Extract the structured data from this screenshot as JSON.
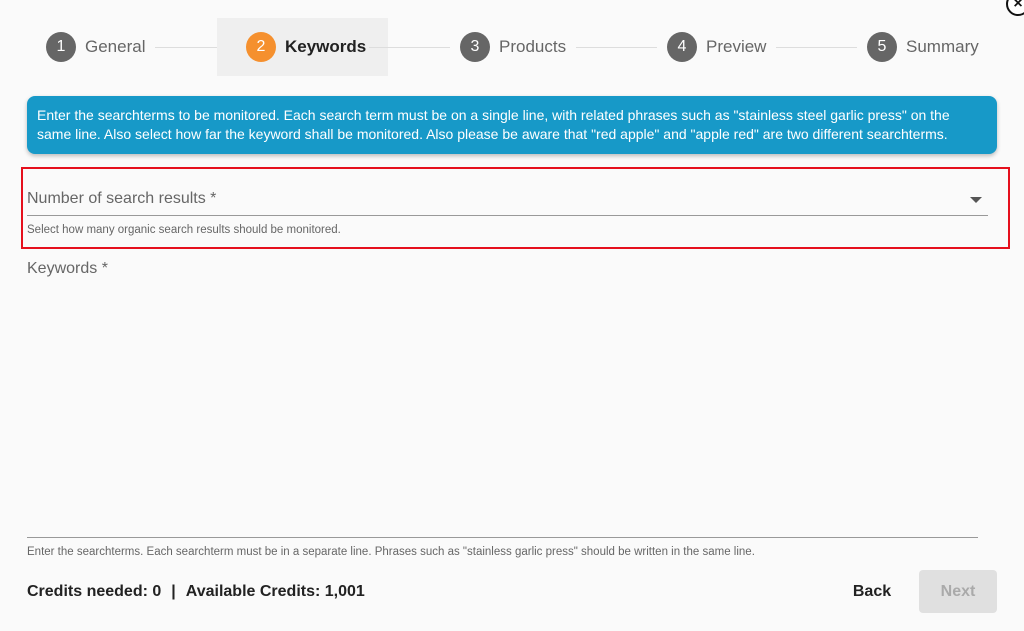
{
  "dialog": {
    "close_icon": "close-circle-icon"
  },
  "stepper": {
    "steps": [
      {
        "number": "1",
        "label": "General",
        "state": "inactive"
      },
      {
        "number": "2",
        "label": "Keywords",
        "state": "active"
      },
      {
        "number": "3",
        "label": "Products",
        "state": "inactive"
      },
      {
        "number": "4",
        "label": "Preview",
        "state": "inactive"
      },
      {
        "number": "5",
        "label": "Summary",
        "state": "inactive"
      }
    ],
    "active_color": "#f5902e",
    "inactive_color": "#666666"
  },
  "info": {
    "text": "Enter the searchterms to be monitored. Each search term must be on a single line, with related phrases such as \"stainless steel garlic press\" on the same line. Also select how far the keyword shall be monitored. Also please be aware that \"red apple\" and \"apple red\" are two different searchterms.",
    "color": "#1799c8"
  },
  "search_results": {
    "label": "Number of search results *",
    "value": "",
    "help": "Select how many organic search results should be monitored.",
    "highlight_color": "#e5101d"
  },
  "keywords": {
    "label": "Keywords *",
    "value": "",
    "help": "Enter the searchterms. Each searchterm must be in a separate line. Phrases such as \"stainless garlic press\" should be written in the same line."
  },
  "footer": {
    "credits_needed_label": "Credits needed: 0",
    "separator": "|",
    "available_credits_label": "Available Credits: 1,001",
    "back_label": "Back",
    "next_label": "Next"
  }
}
